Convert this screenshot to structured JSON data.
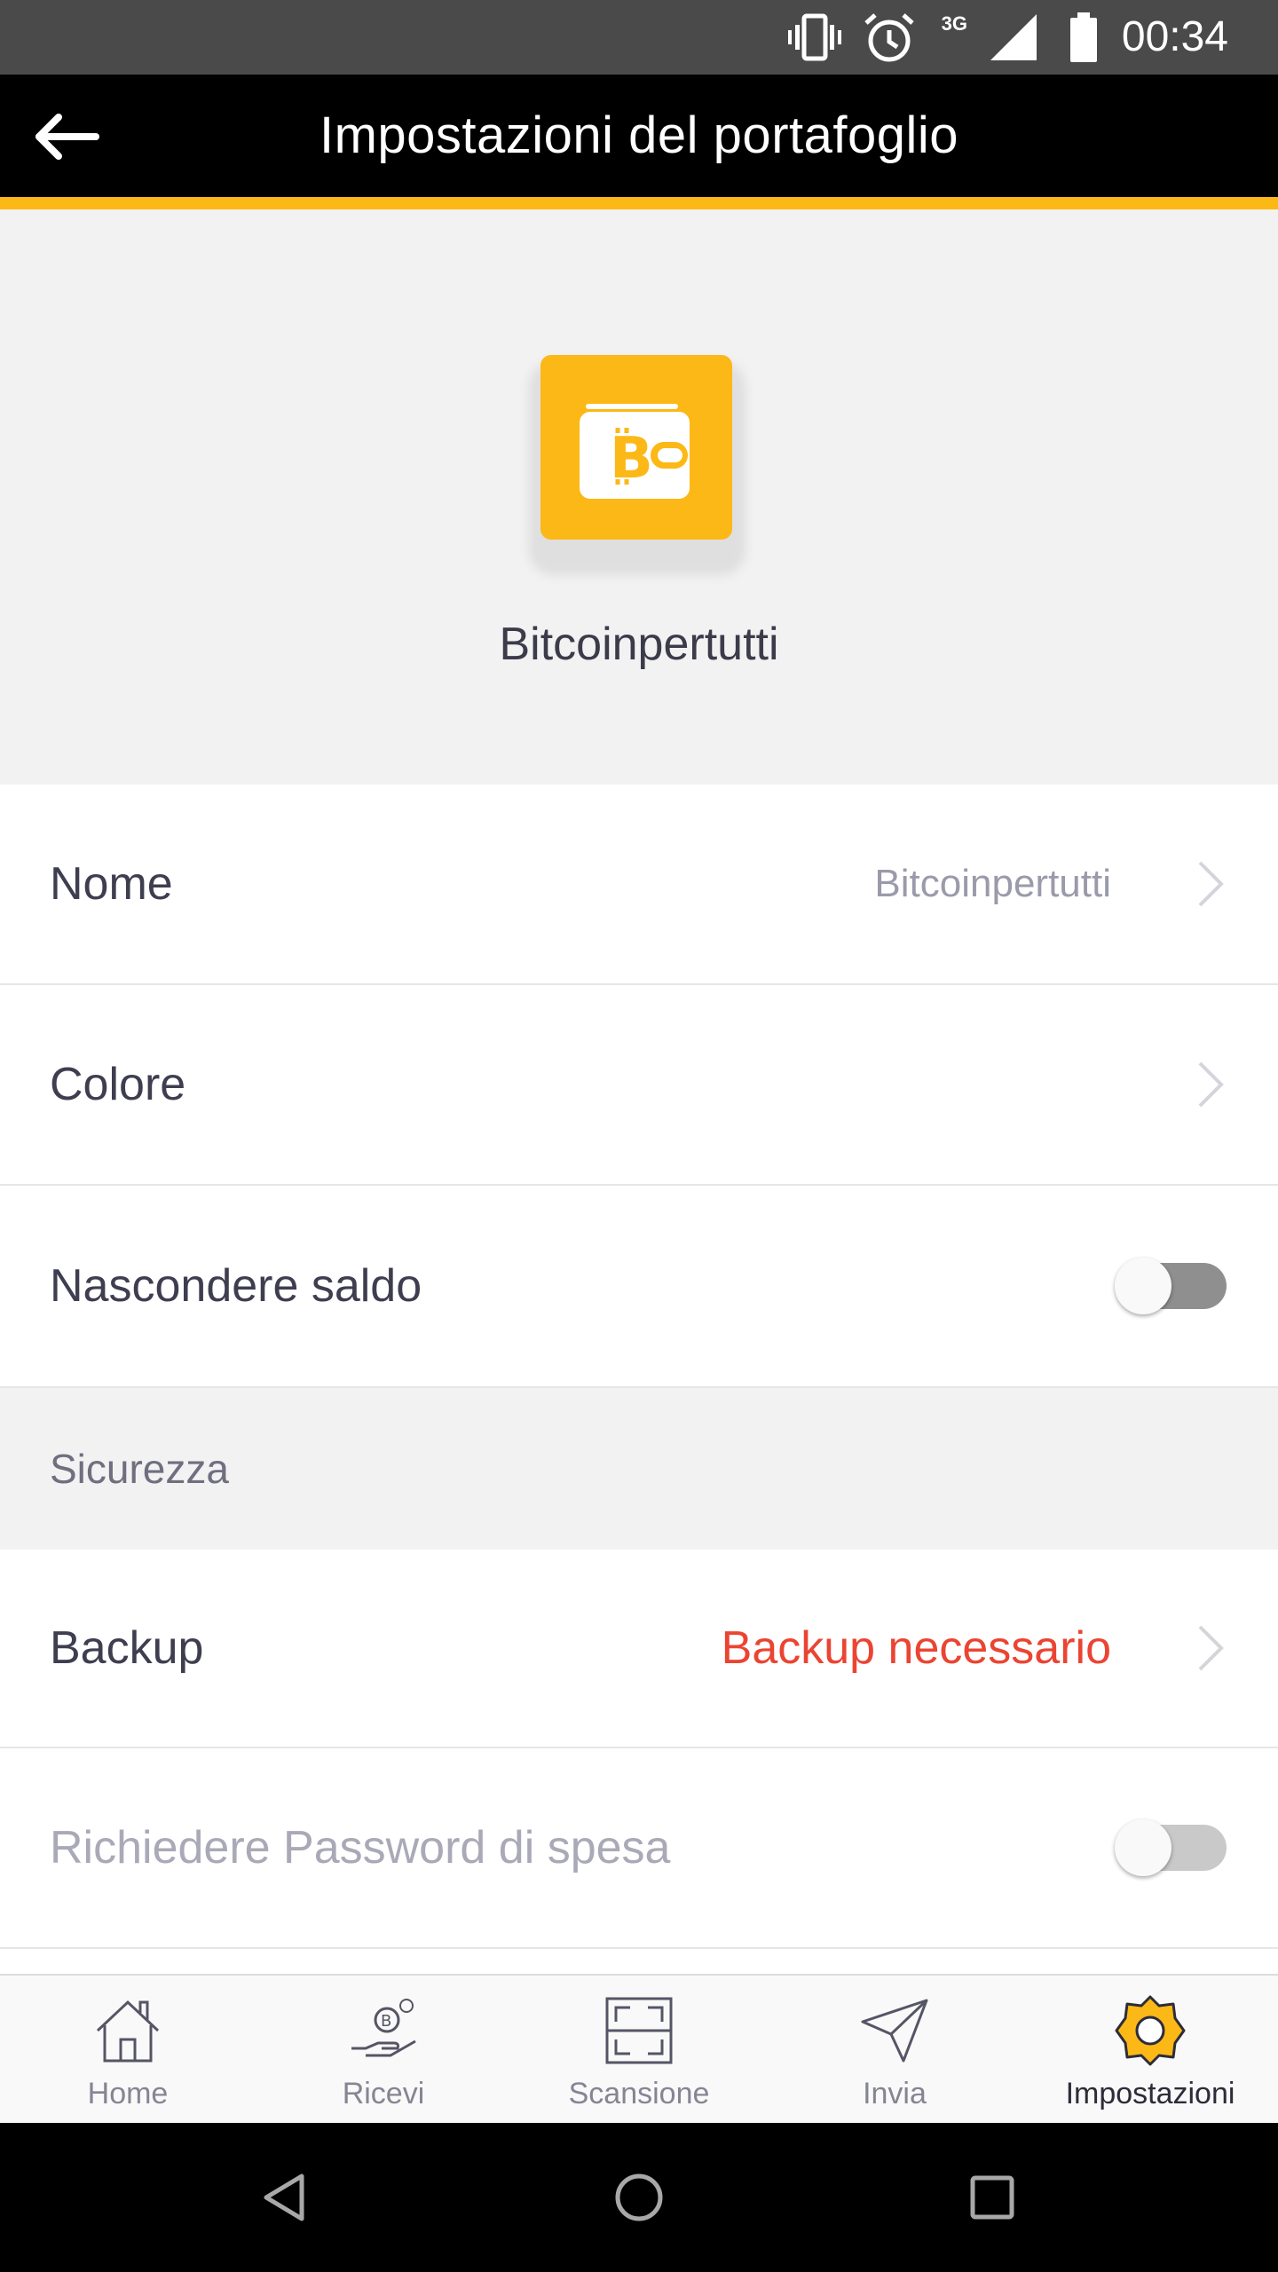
{
  "status_bar": {
    "time": "00:34",
    "network": "3G",
    "icons": [
      "vibrate-icon",
      "alarm-icon",
      "signal-icon",
      "battery-icon"
    ]
  },
  "app_bar": {
    "title": "Impostazioni del portafoglio",
    "back_icon": "arrow-left-icon"
  },
  "wallet": {
    "name": "Bitcoinpertutti",
    "color": "#fcb816",
    "icon": "bitcoin-wallet-icon"
  },
  "settings": {
    "nome": {
      "label": "Nome",
      "value": "Bitcoinpertutti"
    },
    "colore": {
      "label": "Colore"
    },
    "hide_balance": {
      "label": "Nascondere saldo",
      "enabled": false
    }
  },
  "security": {
    "header": "Sicurezza",
    "backup": {
      "label": "Backup",
      "value": "Backup necessario",
      "value_color": "#eb4432"
    },
    "spending_password": {
      "label": "Richiedere Password di spesa",
      "enabled": false,
      "disabled": true
    }
  },
  "tab_bar": {
    "tabs": [
      {
        "label": "Home",
        "icon": "home-icon",
        "active": false
      },
      {
        "label": "Ricevi",
        "icon": "receive-icon",
        "active": false
      },
      {
        "label": "Scansione",
        "icon": "scan-icon",
        "active": false
      },
      {
        "label": "Invia",
        "icon": "send-icon",
        "active": false
      },
      {
        "label": "Impostazioni",
        "icon": "settings-gear-icon",
        "active": true
      }
    ],
    "active_color": "#fcb816"
  },
  "nav_bar": {
    "buttons": [
      "back-triangle-icon",
      "home-circle-icon",
      "recents-square-icon"
    ]
  }
}
